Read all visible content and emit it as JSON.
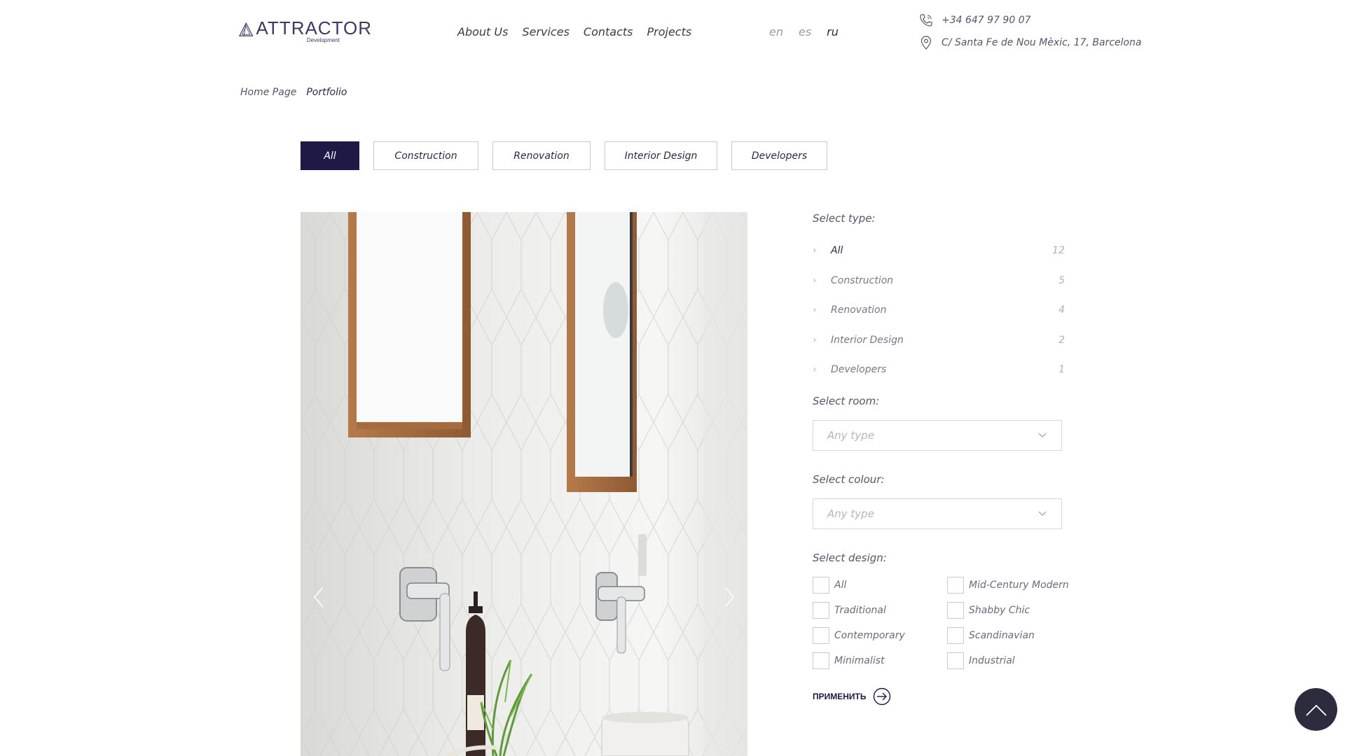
{
  "header": {
    "logo": {
      "name": "ATTRACTOR",
      "tagline": "Development"
    },
    "nav": [
      "About Us",
      "Services",
      "Contacts",
      "Projects"
    ],
    "languages": [
      {
        "code": "en",
        "active": false
      },
      {
        "code": "es",
        "active": false
      },
      {
        "code": "ru",
        "active": true
      }
    ],
    "phone": "+34 647 97 90 07",
    "address": "C/ Santa Fe de Nou Mèxic, 17, Barcelona"
  },
  "breadcrumb": {
    "home": "Home Page",
    "current": "Portfolio"
  },
  "tabs": [
    {
      "label": "All",
      "active": true
    },
    {
      "label": "Construction",
      "active": false
    },
    {
      "label": "Renovation",
      "active": false
    },
    {
      "label": "Interior Design",
      "active": false
    },
    {
      "label": "Developers",
      "active": false
    }
  ],
  "filters": {
    "type_title": "Select type:",
    "types": [
      {
        "label": "All",
        "count": "12"
      },
      {
        "label": "Construction",
        "count": "5"
      },
      {
        "label": "Renovation",
        "count": "4"
      },
      {
        "label": "Interior Design",
        "count": "2"
      },
      {
        "label": "Developers",
        "count": "1"
      }
    ],
    "room_title": "Select room:",
    "room_placeholder": "Any type",
    "colour_title": "Select colour:",
    "colour_placeholder": "Any type",
    "design_title": "Select design:",
    "designs": [
      "All",
      "Mid-Century Modern",
      "Traditional",
      "Shabby Chic",
      "Contemporary",
      "Scandinavian",
      "Minimalist",
      "Industrial"
    ],
    "apply_label": "ПРИМЕНИТЬ"
  },
  "colors": {
    "accent": "#1e1a45",
    "scroll_top_bg": "#2d2c3f"
  }
}
